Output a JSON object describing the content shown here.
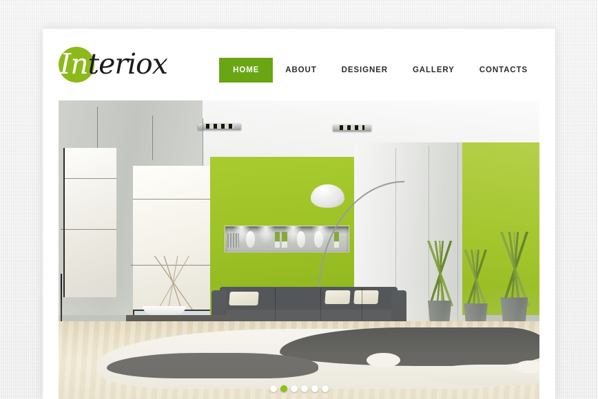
{
  "site": {
    "brand_name": "Interiox",
    "brand_prefix": "In",
    "brand_suffix": "teriox",
    "accent_color": "#6aa613",
    "logo_circle_color": "#8cba1a"
  },
  "nav": {
    "items": [
      {
        "label": "HOME",
        "active": true
      },
      {
        "label": "ABOUT",
        "active": false
      },
      {
        "label": "DESIGNER",
        "active": false
      },
      {
        "label": "GALLERY",
        "active": false
      },
      {
        "label": "CONTACTS",
        "active": false
      }
    ]
  },
  "slider": {
    "total_slides": 6,
    "active_slide": 2,
    "dot_active_color": "#8cc312",
    "dot_inactive_color": "#ffffff",
    "slide": {
      "scene": "modern-living-room-interior",
      "elements": [
        "white-ceiling",
        "recessed-ceiling-spotlights",
        "gray-left-wall",
        "roller-blind-windows",
        "green-accent-wall",
        "illuminated-recessed-niche",
        "dark-gray-sofa",
        "cream-throw-pillows",
        "dark-coffee-table",
        "white-bowl-with-branches",
        "arc-floor-lamp",
        "black-gloss-pedestal",
        "tall-gray-planters-with-grass",
        "black-and-white-shag-rug",
        "light-wood-floor"
      ]
    }
  }
}
